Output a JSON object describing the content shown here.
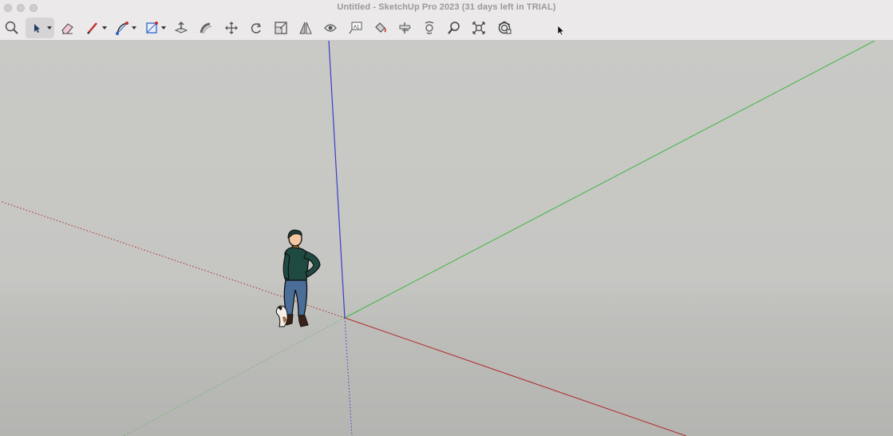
{
  "window": {
    "title": "Untitled - SketchUp Pro 2023 (31 days left in TRIAL)"
  },
  "toolbar": {
    "tools": [
      {
        "name": "zoom-extents",
        "icon": "magnifier-icon"
      },
      {
        "name": "select",
        "icon": "arrow-icon",
        "active": true,
        "has_menu": true
      },
      {
        "name": "eraser",
        "icon": "eraser-icon"
      },
      {
        "name": "line",
        "icon": "pencil-icon",
        "has_menu": true
      },
      {
        "name": "arc",
        "icon": "arc-icon",
        "has_menu": true
      },
      {
        "name": "rectangle",
        "icon": "rectangle-icon",
        "has_menu": true
      },
      {
        "name": "push-pull",
        "icon": "push-pull-icon"
      },
      {
        "name": "follow-me",
        "icon": "follow-me-icon"
      },
      {
        "name": "move",
        "icon": "move-icon"
      },
      {
        "name": "rotate",
        "icon": "rotate-icon"
      },
      {
        "name": "scale",
        "icon": "scale-icon"
      },
      {
        "name": "flip",
        "icon": "flip-icon"
      },
      {
        "name": "offset",
        "icon": "offset-icon"
      },
      {
        "name": "text",
        "icon": "text-icon"
      },
      {
        "name": "paint-bucket",
        "icon": "paint-bucket-icon"
      },
      {
        "name": "position-camera",
        "icon": "position-camera-icon"
      },
      {
        "name": "walk",
        "icon": "walk-icon"
      },
      {
        "name": "zoom",
        "icon": "zoom-icon"
      },
      {
        "name": "zoom-extents-full",
        "icon": "zoom-extents-icon"
      },
      {
        "name": "extension-warehouse",
        "icon": "extension-warehouse-icon"
      }
    ]
  },
  "viewport": {
    "axis_colors": {
      "red": "#b02a2a",
      "green": "#3fb83f",
      "blue": "#3c3cc8"
    },
    "scene_figure": "person-with-dog-icon"
  }
}
